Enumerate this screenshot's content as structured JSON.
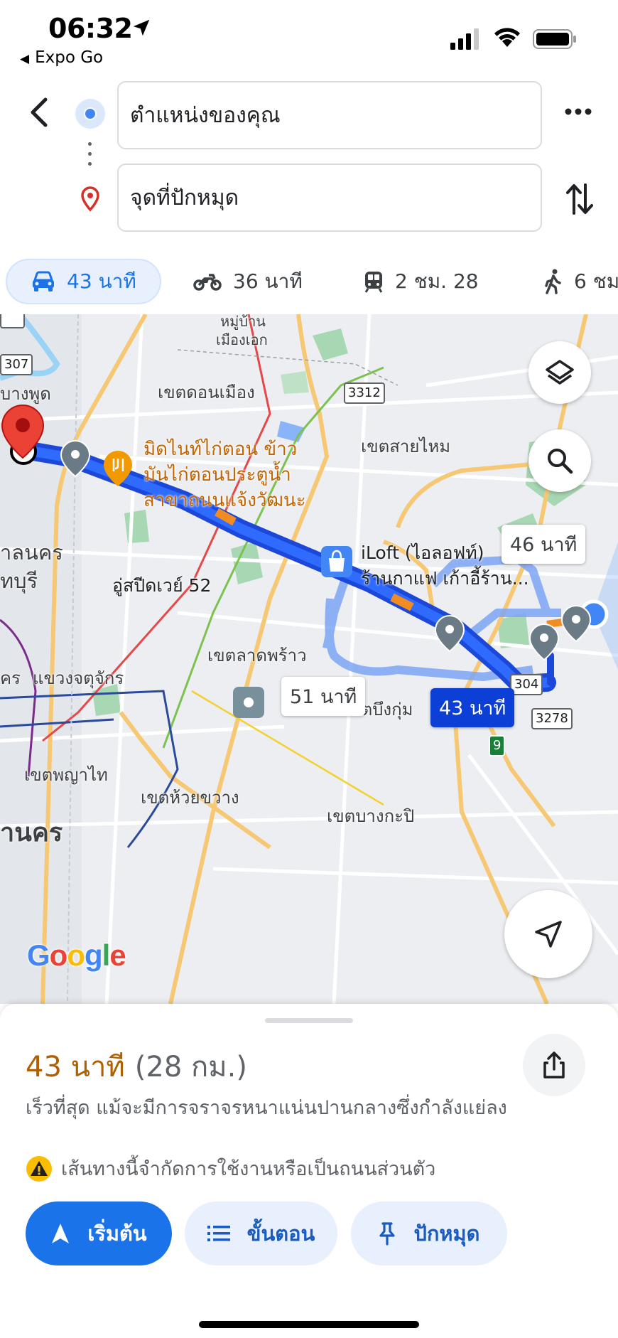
{
  "status_bar": {
    "time": "06:32",
    "back_app": "Expo Go"
  },
  "directions": {
    "origin": "ตำแหน่งของคุณ",
    "destination": "จุดที่ปักหมุด"
  },
  "modes": [
    {
      "label": "43 นาที",
      "icon": "car-icon",
      "active": true
    },
    {
      "label": "36 นาที",
      "icon": "motorcycle-icon",
      "active": false
    },
    {
      "label": "2 ชม. 28",
      "icon": "train-icon",
      "active": false
    },
    {
      "label": "6 ชม",
      "icon": "walk-icon",
      "active": false
    }
  ],
  "map": {
    "labels": {
      "area1": "หมู่บ้าน",
      "area1b": "เมืองเอก",
      "donmueang": "เขตดอนเมือง",
      "saimai": "เขตสายไหม",
      "bangphut": "บางพูด",
      "nakhon": "าลนคร",
      "buri": "ทบุรี",
      "ladphrao": "เขตลาดพร้าว",
      "chatuchak": "แขวงจตุจักร",
      "ru": "ุคร",
      "bueng_kum": "เขตบึงกุ่ม",
      "phaya_thai": "เขตพญาไท",
      "huai_khwang": "เขตห้วยขวาง",
      "bang_kapi": "เขตบางกะปิ",
      "bkk": "านคร"
    },
    "poi_restaurant": [
      "มิดไนท์ไก่ตอน ข้าว",
      "มันไก่ตอนประตูน้ำ",
      "สาขาถนนแจ้งวัฒนะ"
    ],
    "poi_shop": [
      "iLoft (ไอลอฟท์)",
      "ร้านกาแฟ เก้าอี้ร้าน..."
    ],
    "poi_speedway": "อู่สปีดเวย์ 52",
    "shields": {
      "s307": "307",
      "s3312": "3312",
      "s304": "304",
      "s3278": "3278",
      "s9": "9"
    },
    "route_main": "43 นาที",
    "route_alt1": "46 นาที",
    "route_alt2": "51 นาที",
    "google_logo": "Google"
  },
  "sheet": {
    "duration": "43 นาที",
    "distance": "(28 กม.)",
    "description": "เร็วที่สุด แม้จะมีการจราจรหนาแน่นปานกลางซึ่งกำลังแย่ลง",
    "warning": "เส้นทางนี้จำกัดการใช้งานหรือเป็นถนนส่วนตัว",
    "buttons": {
      "start": "เริ่มต้น",
      "steps": "ขั้นตอน",
      "pin": "ปักหมุด"
    }
  },
  "colors": {
    "accent": "#1a73e8",
    "route": "#0b3fd6",
    "duration": "#b06000"
  }
}
